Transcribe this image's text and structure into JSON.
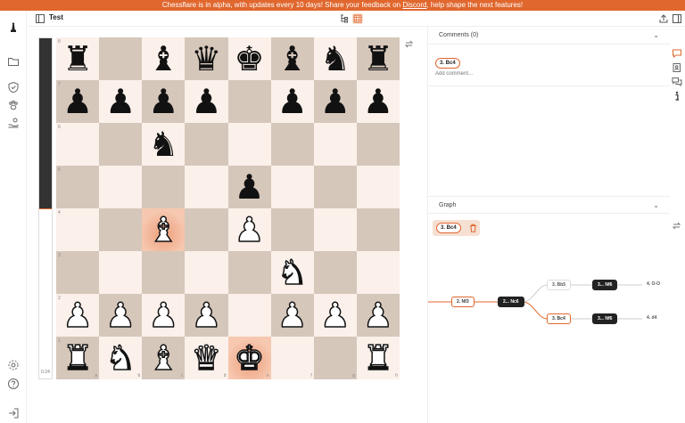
{
  "banner": {
    "text_before": "Chessflare is in alpha, with updates every 10 days! Share your feedback on ",
    "link": "Discord",
    "text_after": ", help shape the next features!"
  },
  "topbar": {
    "title": "Test"
  },
  "eval": {
    "score": "0.24",
    "white_share": 0.5
  },
  "board": {
    "ranks": [
      "8",
      "7",
      "6",
      "5",
      "4",
      "3",
      "2",
      "1"
    ],
    "files": [
      "a",
      "b",
      "c",
      "d",
      "e",
      "f",
      "g",
      "h"
    ],
    "rows": [
      [
        "bR",
        "",
        "bB",
        "bQ",
        "bK",
        "bB",
        "bN",
        "bR"
      ],
      [
        "bP",
        "bP",
        "bP",
        "bP",
        "",
        "bP",
        "bP",
        "bP"
      ],
      [
        "",
        "",
        "bN",
        "",
        "",
        "",
        "",
        ""
      ],
      [
        "",
        "",
        "",
        "",
        "bP",
        "",
        "",
        ""
      ],
      [
        "",
        "",
        "wB",
        "",
        "wP",
        "",
        "",
        ""
      ],
      [
        "",
        "",
        "",
        "",
        "",
        "wN",
        "",
        ""
      ],
      [
        "wP",
        "wP",
        "wP",
        "wP",
        "",
        "wP",
        "wP",
        "wP"
      ],
      [
        "wR",
        "wN",
        "wB",
        "wQ",
        "wK",
        "",
        "",
        "wR"
      ]
    ],
    "highlight": [
      "e1",
      "c4"
    ]
  },
  "comments": {
    "title": "Comments (0)",
    "move": "3. Bc4",
    "placeholder": "Add comment..."
  },
  "graph": {
    "title": "Graph",
    "selected": "3. Bc4",
    "nodes": {
      "nf3": "2. Nf3",
      "nc6": "2... Nc6",
      "bb5": "3. Bb5",
      "bb5_nf6": "3... Nf6",
      "oo": "4. O-O",
      "bc4": "3. Bc4",
      "bc4_nf6": "3... Nf6",
      "d4": "4. d4"
    }
  },
  "colors": {
    "accent": "#e0672e",
    "light_square": "#fbf0ea",
    "dark_square": "#d6c7bb",
    "highlight": "#ee9f7c"
  }
}
